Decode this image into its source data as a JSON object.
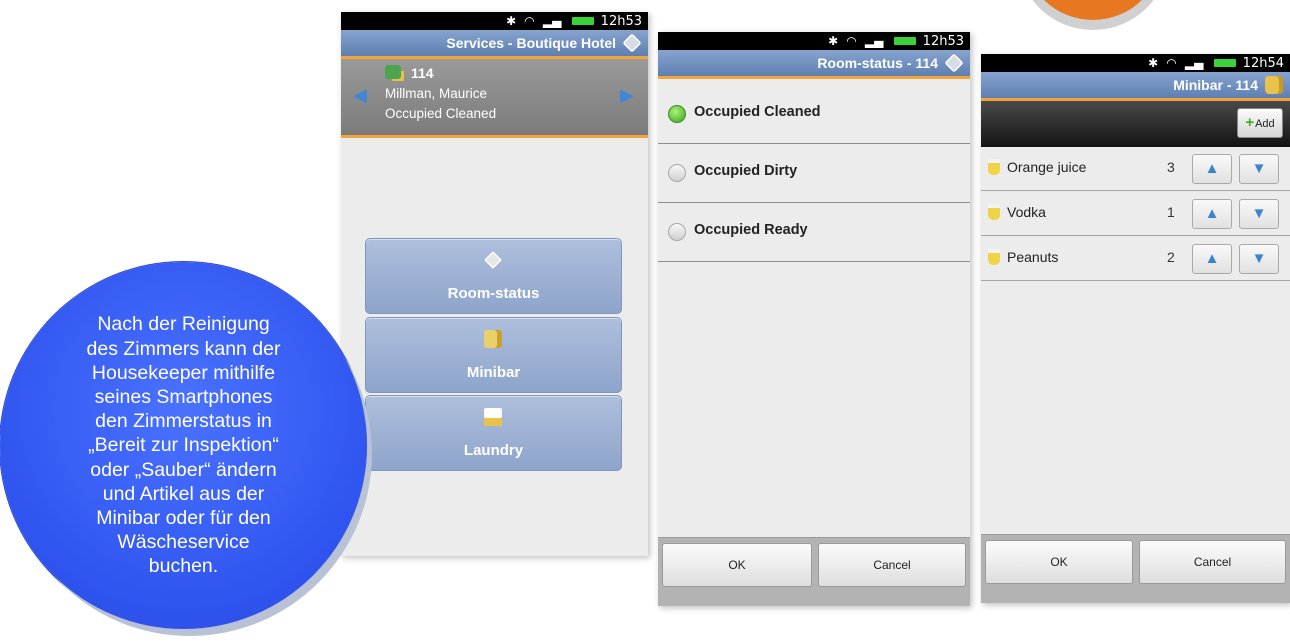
{
  "info_bubble": {
    "text_lines": [
      "Nach der Reinigung",
      "des Zimmers kann der",
      "Housekeeper mithilfe",
      "seines Smartphones",
      "den Zimmerstatus in",
      "„Bereit zur Inspektion“",
      "oder „Sauber“ ändern",
      "und Artikel aus der",
      "Minibar oder für den",
      "Wäscheservice",
      "buchen."
    ]
  },
  "phone_services": {
    "statusbar_time": "12h53",
    "title": "Services - Boutique Hotel",
    "room_number": "114",
    "guest_name": "Millman, Maurice",
    "room_status": "Occupied Cleaned",
    "buttons": [
      {
        "label": "Room-status",
        "icon": "tag-icon"
      },
      {
        "label": "Minibar",
        "icon": "bottles-icon"
      },
      {
        "label": "Laundry",
        "icon": "laundry-icon"
      }
    ]
  },
  "phone_room_status": {
    "statusbar_time": "12h53",
    "title": "Room-status - 114",
    "options": [
      {
        "label": "Occupied Cleaned",
        "selected": true
      },
      {
        "label": "Occupied Dirty",
        "selected": false
      },
      {
        "label": "Occupied Ready",
        "selected": false
      }
    ],
    "ok_label": "OK",
    "cancel_label": "Cancel"
  },
  "phone_minibar": {
    "statusbar_time": "12h54",
    "title": "Minibar - 114",
    "add_label": "Add",
    "items": [
      {
        "name": "Orange juice",
        "qty": "3"
      },
      {
        "name": "Vodka",
        "qty": "1"
      },
      {
        "name": "Peanuts",
        "qty": "2"
      }
    ],
    "ok_label": "OK",
    "cancel_label": "Cancel"
  }
}
